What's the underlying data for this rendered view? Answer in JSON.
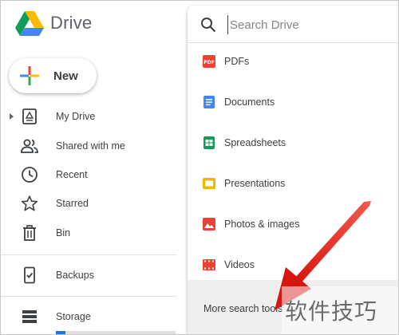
{
  "app": {
    "name": "Drive"
  },
  "new_button": {
    "label": "New"
  },
  "sidebar": {
    "items": [
      {
        "label": "My Drive",
        "icon": "my-drive-icon",
        "expandable": true
      },
      {
        "label": "Shared with me",
        "icon": "shared-icon"
      },
      {
        "label": "Recent",
        "icon": "clock-icon"
      },
      {
        "label": "Starred",
        "icon": "star-icon"
      },
      {
        "label": "Bin",
        "icon": "trash-icon"
      }
    ],
    "backups": {
      "label": "Backups",
      "icon": "backup-phone-icon"
    },
    "storage": {
      "label": "Storage",
      "icon": "storage-icon",
      "used_fraction": 0.08
    }
  },
  "search": {
    "placeholder": "Search Drive",
    "types": [
      {
        "label": "PDFs",
        "icon": "pdf-icon",
        "color": "#ea4335"
      },
      {
        "label": "Documents",
        "icon": "docs-icon",
        "color": "#4285f4"
      },
      {
        "label": "Spreadsheets",
        "icon": "sheets-icon",
        "color": "#0f9d58"
      },
      {
        "label": "Presentations",
        "icon": "slides-icon",
        "color": "#f4b400"
      },
      {
        "label": "Photos & images",
        "icon": "image-icon",
        "color": "#ea4335"
      },
      {
        "label": "Videos",
        "icon": "video-icon",
        "color": "#ea4335"
      }
    ],
    "more_tools": "More search tools"
  },
  "watermark": {
    "text": "软件技巧"
  },
  "colors": {
    "accent": "#1a73e8",
    "annotation": "#e8231c"
  }
}
